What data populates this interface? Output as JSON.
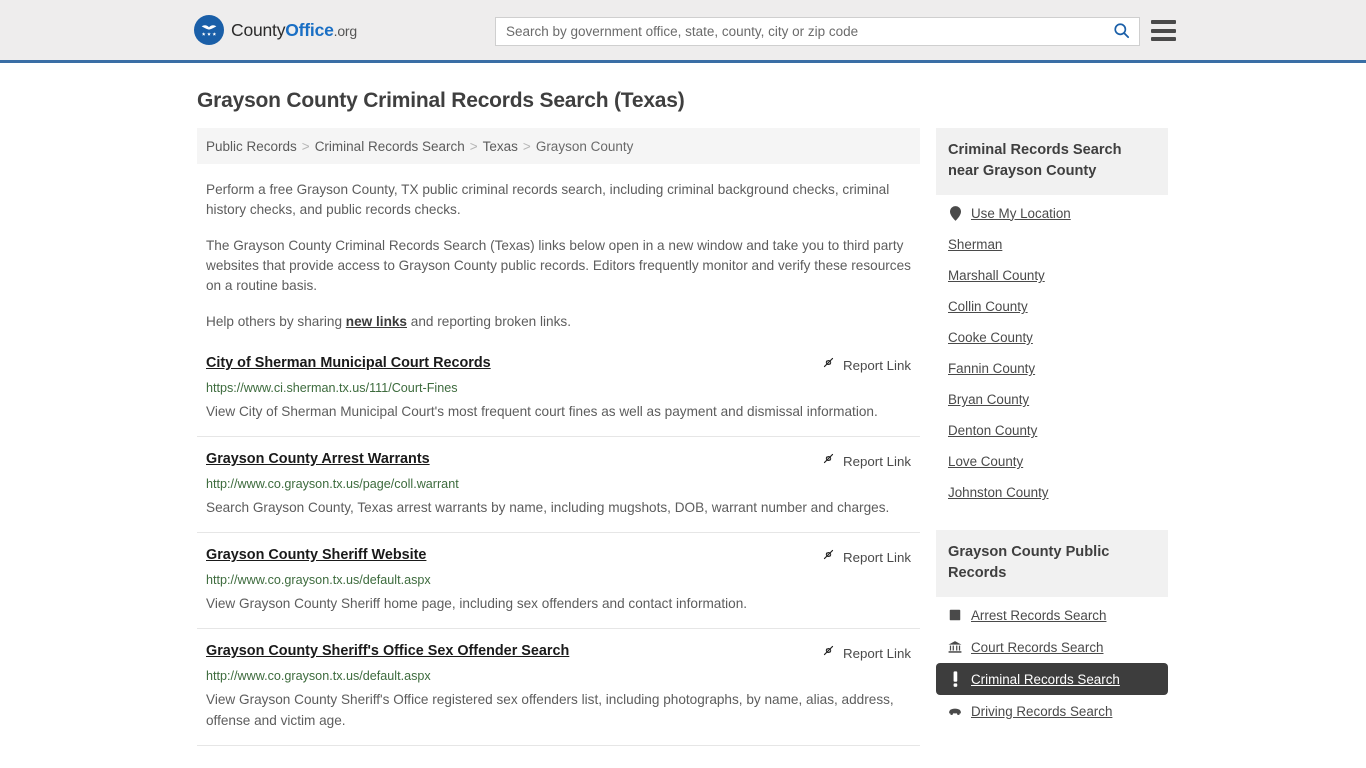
{
  "header": {
    "logo": {
      "icon": "eagle-shield-logo-icon",
      "part1": "County",
      "part2": "Office",
      "part3": ".org"
    },
    "search": {
      "placeholder": "Search by government office, state, county, city or zip code",
      "value": "",
      "search_icon": "search-icon"
    },
    "menu_icon": "hamburger-menu-icon"
  },
  "page": {
    "title": "Grayson County Criminal Records Search (Texas)"
  },
  "breadcrumb": {
    "separator": ">",
    "items": [
      {
        "label": "Public Records",
        "current": false
      },
      {
        "label": "Criminal Records Search",
        "current": false
      },
      {
        "label": "Texas",
        "current": false
      },
      {
        "label": "Grayson County",
        "current": true
      }
    ]
  },
  "intro": {
    "p1": "Perform a free Grayson County, TX public criminal records search, including criminal background checks, criminal history checks, and public records checks.",
    "p2": "The Grayson County Criminal Records Search (Texas) links below open in a new window and take you to third party websites that provide access to Grayson County public records. Editors frequently monitor and verify these resources on a routine basis.",
    "p3_before": "Help others by sharing ",
    "p3_link": "new links",
    "p3_after": " and reporting broken links."
  },
  "results": {
    "report_label": "Report Link",
    "report_icon": "broken-link-icon",
    "items": [
      {
        "title": "City of Sherman Municipal Court Records",
        "url": "https://www.ci.sherman.tx.us/111/Court-Fines",
        "description": "View City of Sherman Municipal Court's most frequent court fines as well as payment and dismissal information."
      },
      {
        "title": "Grayson County Arrest Warrants",
        "url": "http://www.co.grayson.tx.us/page/coll.warrant",
        "description": "Search Grayson County, Texas arrest warrants by name, including mugshots, DOB, warrant number and charges."
      },
      {
        "title": "Grayson County Sheriff Website",
        "url": "http://www.co.grayson.tx.us/default.aspx",
        "description": "View Grayson County Sheriff home page, including sex offenders and contact information."
      },
      {
        "title": "Grayson County Sheriff's Office Sex Offender Search",
        "url": "http://www.co.grayson.tx.us/default.aspx",
        "description": "View Grayson County Sheriff's Office registered sex offenders list, including photographs, by name, alias, address, offense and victim age."
      }
    ]
  },
  "sidebar": {
    "nearby": {
      "title": "Criminal Records Search near Grayson County",
      "use_my_location": {
        "label": "Use My Location",
        "icon": "map-pin-icon"
      },
      "items": [
        {
          "label": "Sherman"
        },
        {
          "label": "Marshall County"
        },
        {
          "label": "Collin County"
        },
        {
          "label": "Cooke County"
        },
        {
          "label": "Fannin County"
        },
        {
          "label": "Bryan County"
        },
        {
          "label": "Denton County"
        },
        {
          "label": "Love County"
        },
        {
          "label": "Johnston County"
        }
      ]
    },
    "public_records": {
      "title": "Grayson County Public Records",
      "items": [
        {
          "label": "Arrest Records Search",
          "icon": "fingerprint-square-icon",
          "active": false
        },
        {
          "label": "Court Records Search",
          "icon": "courthouse-icon",
          "active": false
        },
        {
          "label": "Criminal Records Search",
          "icon": "exclamation-icon",
          "active": true
        },
        {
          "label": "Driving Records Search",
          "icon": "car-icon",
          "active": false
        }
      ]
    }
  },
  "colors": {
    "header_bg": "#eeeded",
    "header_border": "#3a6ea5",
    "brand_blue": "#1a6fc4",
    "url_green": "#3d6b3d",
    "active_bg": "#3d3d3d",
    "panel_bg": "#f1f1f1"
  }
}
